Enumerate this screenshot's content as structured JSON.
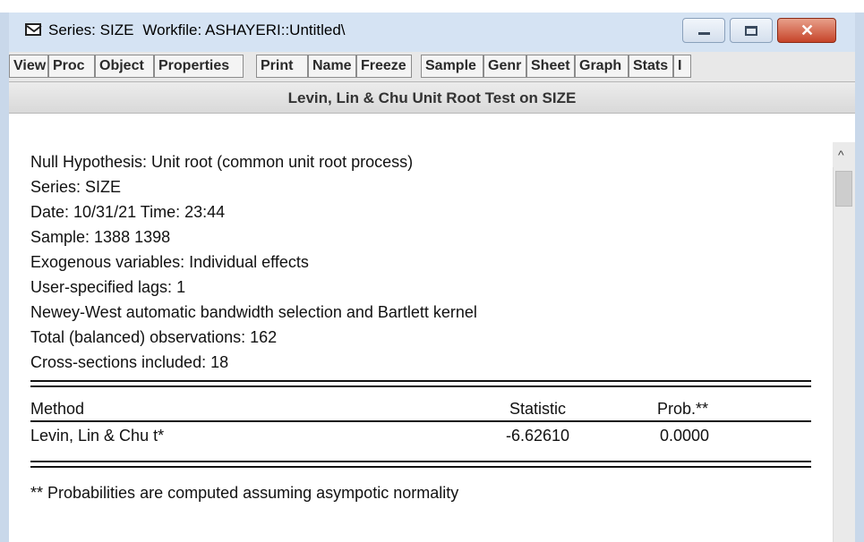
{
  "window": {
    "title_series": "Series: SIZE",
    "title_workfile": "Workfile: ASHAYERI::Untitled\\",
    "min_glyph": "minimize-icon",
    "max_glyph": "maximize-icon",
    "close_glyph": "✕"
  },
  "toolbar": {
    "buttons": [
      "View",
      "Proc",
      "Object",
      "Properties",
      "Print",
      "Name",
      "Freeze",
      "Sample",
      "Genr",
      "Sheet",
      "Graph",
      "Stats",
      "I"
    ]
  },
  "header": {
    "title": "Levin, Lin & Chu Unit Root Test on SIZE"
  },
  "output": {
    "lines": [
      "Null Hypothesis: Unit root (common unit root process)",
      "Series:  SIZE",
      "Date: 10/31/21   Time: 23:44",
      "Sample: 1388 1398",
      "Exogenous variables: Individual effects",
      "User-specified lags: 1",
      "Newey-West automatic bandwidth selection and Bartlett kernel",
      "Total (balanced) observations: 162",
      "Cross-sections included: 18"
    ],
    "table": {
      "columns": [
        "Method",
        "Statistic",
        "Prob.**"
      ],
      "rows": [
        [
          "Levin, Lin & Chu t*",
          "-6.62610",
          "0.0000"
        ]
      ]
    },
    "footnote": "** Probabilities are computed assuming asympotic normality"
  },
  "scrollbar": {
    "up_glyph": "^"
  },
  "colors": {
    "titlebar": "#d5e3f3",
    "close_button": "#c6442a",
    "toolbar": "#e8e8e8"
  }
}
